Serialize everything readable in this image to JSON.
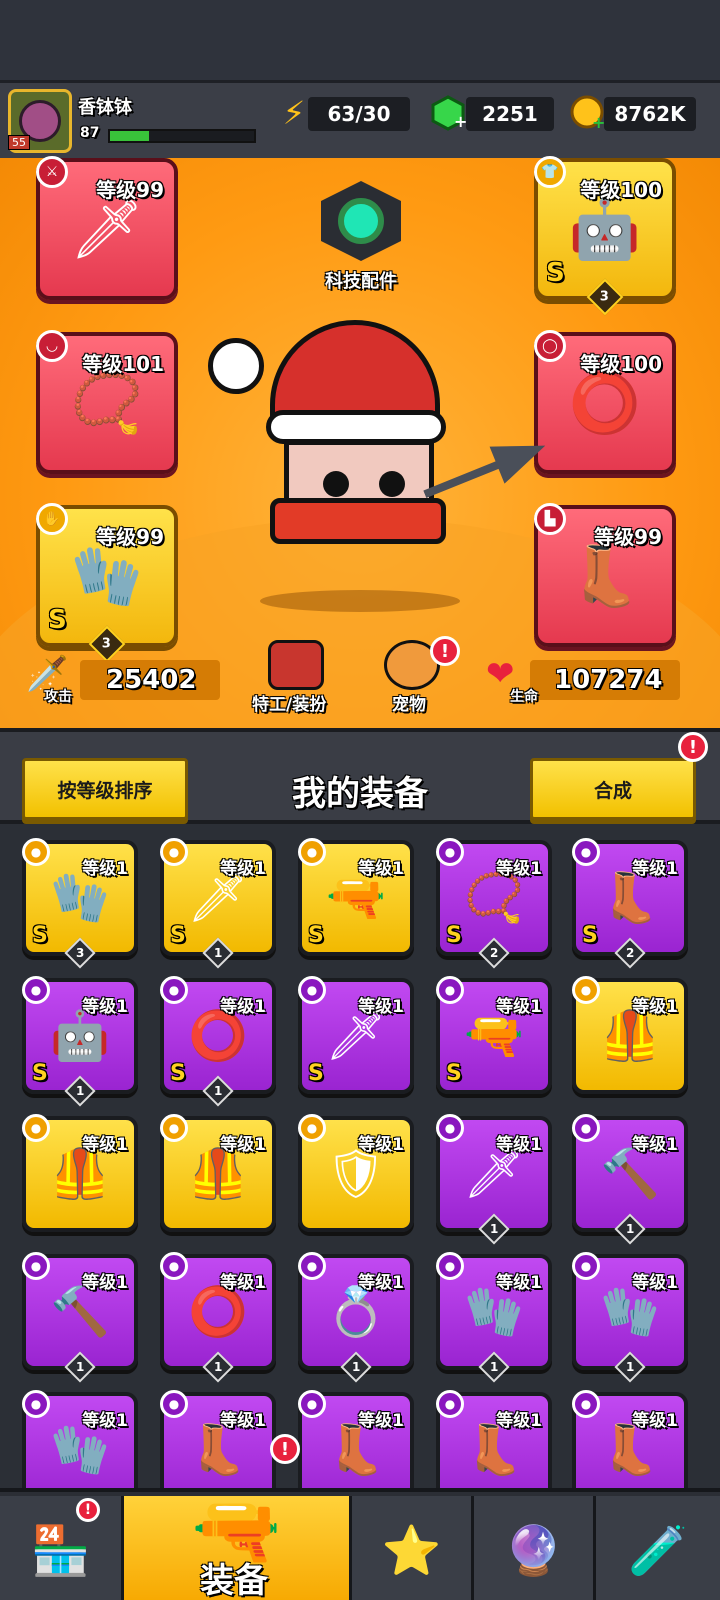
{
  "player": {
    "name": "香钵钵",
    "level_badge": "55",
    "xp_value": "87",
    "xp_fraction": 0.27
  },
  "resources": {
    "energy": "63/30",
    "gems": "2251",
    "coins": "8762K"
  },
  "tech": {
    "label": "科技配件"
  },
  "equipped": [
    {
      "level": "等级99",
      "type": "weapon",
      "icon": "kunai",
      "style": "red",
      "s_rank": false,
      "count": null
    },
    {
      "level": "等级100",
      "type": "armor",
      "icon": "mech-armor",
      "style": "gold",
      "s_rank": true,
      "count": "3"
    },
    {
      "level": "等级101",
      "type": "necklace",
      "icon": "necklace",
      "style": "red",
      "s_rank": false,
      "count": null
    },
    {
      "level": "等级100",
      "type": "belt",
      "icon": "belt",
      "style": "red",
      "s_rank": false,
      "count": null
    },
    {
      "level": "等级99",
      "type": "glove",
      "icon": "mech-glove",
      "style": "gold",
      "s_rank": true,
      "count": "3"
    },
    {
      "level": "等级99",
      "type": "boots",
      "icon": "boots",
      "style": "red",
      "s_rank": false,
      "count": null
    }
  ],
  "stats": {
    "attack_label": "攻击",
    "attack_value": "25402",
    "hp_label": "生命",
    "hp_value": "107274"
  },
  "hero_links": {
    "agent_label": "特工/装扮",
    "pet_label": "宠物",
    "pet_alert": "!"
  },
  "section": {
    "sort_button": "按等级排序",
    "title": "我的装备",
    "merge_button": "合成",
    "merge_alert": "!"
  },
  "inventory": [
    {
      "level": "等级1",
      "style": "gold",
      "s": "S",
      "count": "3",
      "icon": "🧤"
    },
    {
      "level": "等级1",
      "style": "gold",
      "s": "S",
      "count": "1",
      "icon": "🗡"
    },
    {
      "level": "等级1",
      "style": "gold",
      "s": "S",
      "count": "",
      "icon": "🔫"
    },
    {
      "level": "等级1",
      "style": "purple",
      "s": "S",
      "count": "2",
      "icon": "📿"
    },
    {
      "level": "等级1",
      "style": "purple",
      "s": "S",
      "count": "2",
      "icon": "👢"
    },
    {
      "level": "等级1",
      "style": "purple",
      "s": "S",
      "count": "1",
      "icon": "🤖"
    },
    {
      "level": "等级1",
      "style": "purple",
      "s": "S",
      "count": "1",
      "icon": "⭕"
    },
    {
      "level": "等级1",
      "style": "purple",
      "s": "S",
      "count": "",
      "icon": "🗡"
    },
    {
      "level": "等级1",
      "style": "purple",
      "s": "S",
      "count": "",
      "icon": "🔫"
    },
    {
      "level": "等级1",
      "style": "gold",
      "s": "",
      "count": "",
      "icon": "🦺"
    },
    {
      "level": "等级1",
      "style": "gold",
      "s": "",
      "count": "",
      "icon": "🦺"
    },
    {
      "level": "等级1",
      "style": "gold",
      "s": "",
      "count": "",
      "icon": "🦺"
    },
    {
      "level": "等级1",
      "style": "gold",
      "s": "",
      "count": "",
      "icon": "🛡"
    },
    {
      "level": "等级1",
      "style": "purple",
      "s": "",
      "count": "1",
      "icon": "🗡"
    },
    {
      "level": "等级1",
      "style": "purple",
      "s": "",
      "count": "1",
      "icon": "🔨"
    },
    {
      "level": "等级1",
      "style": "purple",
      "s": "",
      "count": "1",
      "icon": "🔨"
    },
    {
      "level": "等级1",
      "style": "purple",
      "s": "",
      "count": "1",
      "icon": "⭕"
    },
    {
      "level": "等级1",
      "style": "purple",
      "s": "",
      "count": "1",
      "icon": "💍"
    },
    {
      "level": "等级1",
      "style": "purple",
      "s": "",
      "count": "1",
      "icon": "🧤"
    },
    {
      "level": "等级1",
      "style": "purple",
      "s": "",
      "count": "1",
      "icon": "🧤"
    },
    {
      "level": "等级1",
      "style": "purple",
      "s": "",
      "count": "",
      "icon": "🧤"
    },
    {
      "level": "等级1",
      "style": "purple",
      "s": "",
      "count": "",
      "icon": "👢"
    },
    {
      "level": "等级1",
      "style": "purple",
      "s": "",
      "count": "",
      "icon": "👢"
    },
    {
      "level": "等级1",
      "style": "purple",
      "s": "",
      "count": "",
      "icon": "👢"
    },
    {
      "level": "等级1",
      "style": "purple",
      "s": "",
      "count": "",
      "icon": "👢"
    }
  ],
  "nav": {
    "shop_alert": "!",
    "equip_label": "装备",
    "equip_alert": "!"
  }
}
